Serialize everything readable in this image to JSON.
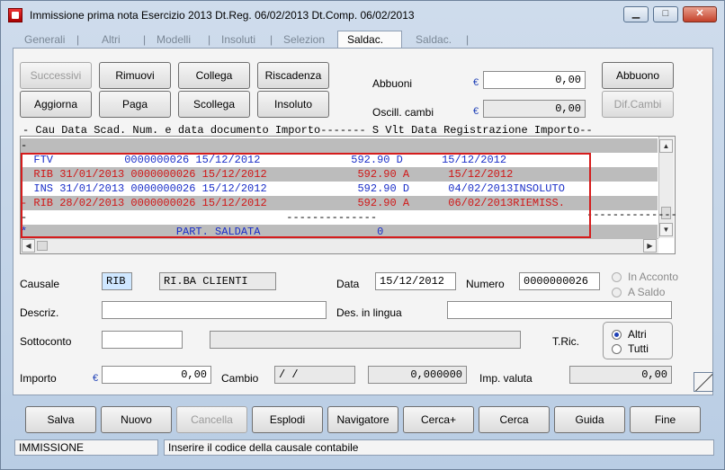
{
  "window": {
    "title": "Immissione prima nota  Esercizio 2013  Dt.Reg. 06/02/2013  Dt.Comp. 06/02/2013",
    "minimize": "▁",
    "maximize": "□",
    "close": "✕"
  },
  "tabs": [
    "Generali",
    "Altri",
    "Modelli",
    "Insoluti",
    "Selezion",
    "Saldac.",
    "Saldac."
  ],
  "tab_separator": "|",
  "toolbar": {
    "successivi": "Successivi",
    "rimuovi": "Rimuovi",
    "collega": "Collega",
    "riscadenza": "Riscadenza",
    "aggiorna": "Aggiorna",
    "paga": "Paga",
    "scollega": "Scollega",
    "insoluto": "Insoluto",
    "abbuono": "Abbuono",
    "dif_cambi": "Dif.Cambi"
  },
  "abbuoni": {
    "label": "Abbuoni",
    "value": "0,00"
  },
  "oscill": {
    "label": "Oscill. cambi",
    "value": "0,00"
  },
  "currency_symbol": "€",
  "grid": {
    "header": "- Cau Data Scad. Num. e data documento Importo------- S Vlt Data Registrazione Importo--",
    "header_dashes": "--------------",
    "rows": [
      {
        "text": "-",
        "style": "grey"
      },
      {
        "text": "  FTV           0000000026 15/12/2012              592.90 D      15/12/2012",
        "style": "blue"
      },
      {
        "text": "  RIB 31/01/2013 0000000026 15/12/2012              592.90 A      15/12/2012",
        "style": "grey red"
      },
      {
        "text": "  INS 31/01/2013 0000000026 15/12/2012              592.90 D      04/02/2013INSOLUTO",
        "style": "blue"
      },
      {
        "text": "- RIB 28/02/2013 0000000026 15/12/2012              592.90 A      06/02/2013RIEMISS.",
        "style": "grey red"
      },
      {
        "text": "-                                        --------------",
        "style": ""
      },
      {
        "text": "*                       PART. SALDATA                  0",
        "style": "grey blue"
      }
    ]
  },
  "form": {
    "causale_label": "Causale",
    "causale_code": "RIB",
    "causale_desc": "RI.BA CLIENTI",
    "data_label": "Data",
    "data_value": "15/12/2012",
    "numero_label": "Numero",
    "numero_value": "0000000026",
    "in_acconto": "In Acconto",
    "a_saldo": "A Saldo",
    "descriz_label": "Descriz.",
    "descriz_value": "",
    "des_lingua_label": "Des. in lingua",
    "des_lingua_value": "",
    "sottoconto_label": "Sottoconto",
    "sottoconto_value": "",
    "tric_label": "T.Ric.",
    "altri": "Altri",
    "tutti": "Tutti",
    "importo_label": "Importo",
    "importo_value": "0,00",
    "cambio_label": "Cambio",
    "cambio_date": " /  /",
    "cambio_value": "0,000000",
    "imp_valuta_label": "Imp. valuta",
    "imp_valuta_value": "0,00"
  },
  "footer": {
    "salva": "Salva",
    "nuovo": "Nuovo",
    "cancella": "Cancella",
    "esplodi": "Esplodi",
    "navigatore": "Navigatore",
    "cerca_plus": "Cerca+",
    "cerca": "Cerca",
    "guida": "Guida",
    "fine": "Fine"
  },
  "status": {
    "mode": "IMMISSIONE",
    "hint": "Inserire il codice della causale contabile"
  }
}
